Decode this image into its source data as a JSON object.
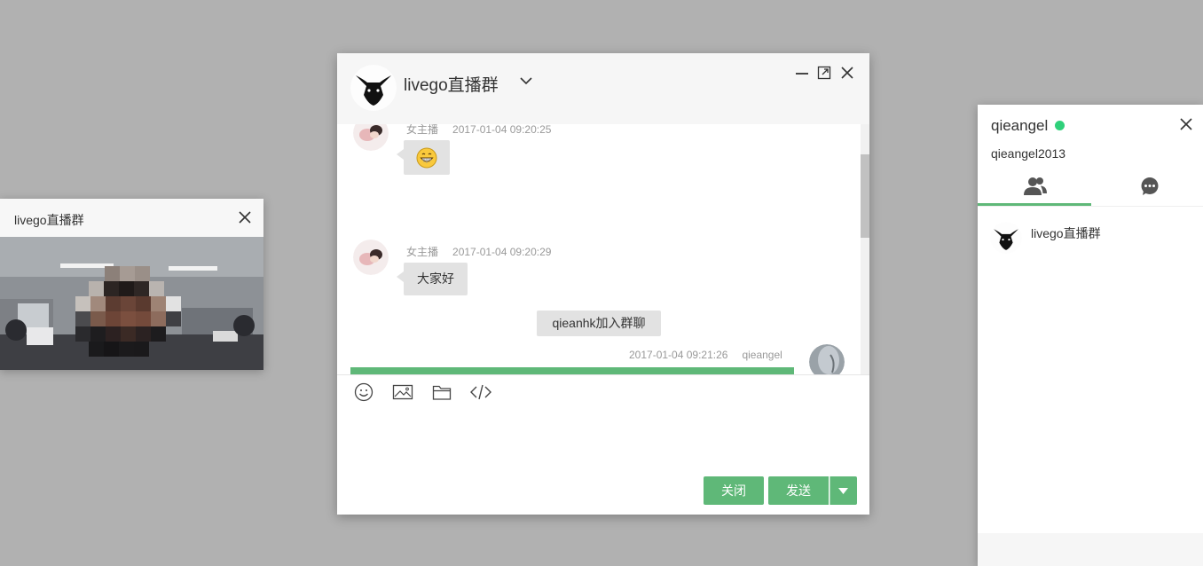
{
  "video_window": {
    "title": "livego直播群"
  },
  "chat_window": {
    "title": "livego直播群",
    "messages": [
      {
        "sender": "女主播",
        "time": "2017-01-04 09:20:25",
        "content": "😁",
        "content_type": "emoji"
      },
      {
        "sender": "女主播",
        "time": "2017-01-04 09:20:29",
        "content": "大家好",
        "content_type": "text"
      },
      {
        "system_note": "qieanhk加入群聊"
      },
      {
        "sender": "qieangel",
        "time": "2017-01-04 09:21:26",
        "content_type": "image"
      }
    ],
    "toolbar": [
      "smile-icon",
      "image-icon",
      "folder-icon",
      "code-icon"
    ],
    "editor_value": "",
    "buttons": {
      "close": "关闭",
      "send": "发送"
    }
  },
  "profile_panel": {
    "name": "qieangel",
    "online": true,
    "status_color": "#2fd07a",
    "account": "qieangel2013",
    "tabs": [
      "contacts-icon",
      "chat-icon"
    ],
    "active_tab": 0,
    "groups": [
      {
        "name": "livego直播群"
      }
    ]
  },
  "colors": {
    "accent": "#5fb878",
    "bubble": "#e2e2e2",
    "desktop": "#b1b1b1"
  }
}
